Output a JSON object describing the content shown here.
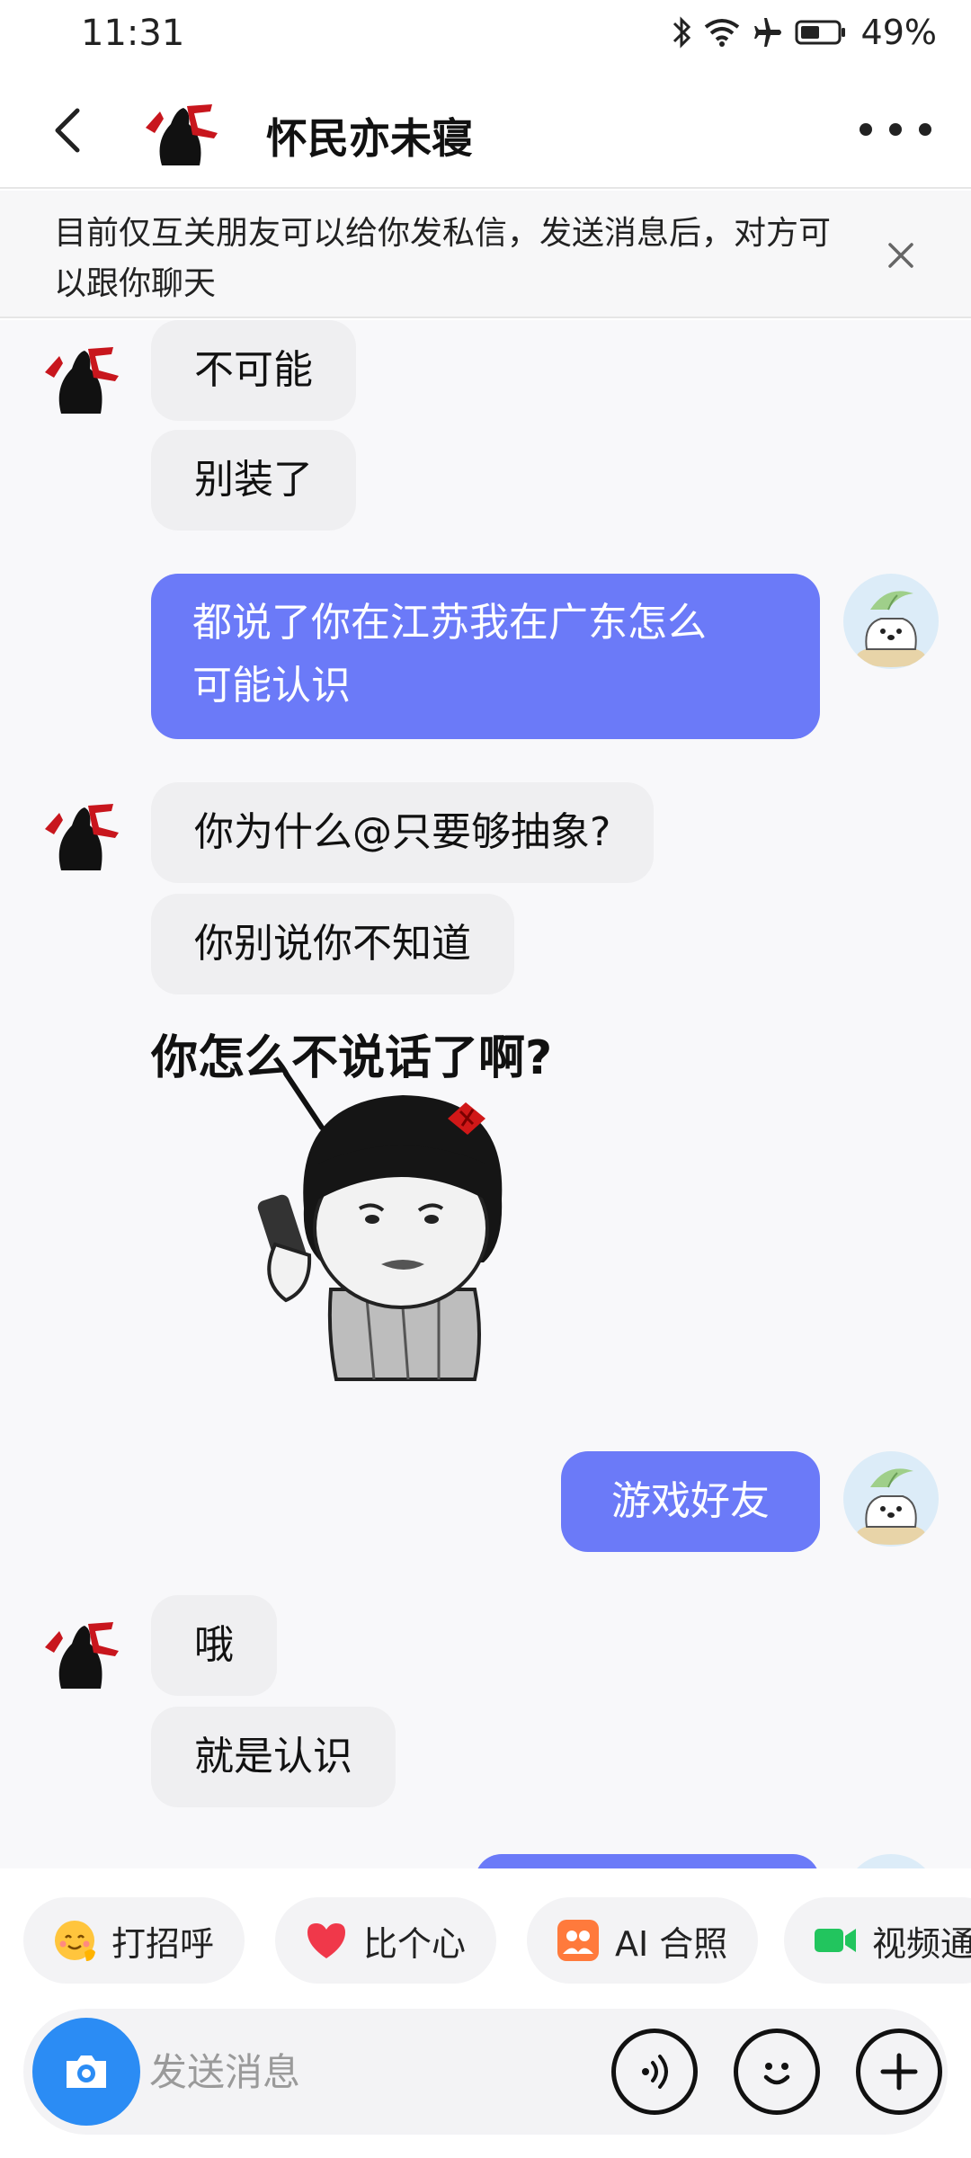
{
  "status_bar": {
    "time": "11:31",
    "battery": "49%"
  },
  "header": {
    "title": "怀民亦未寝"
  },
  "notice": {
    "text": "目前仅互关朋友可以给你发私信，发送消息后，对方可以跟你聊天"
  },
  "messages": [
    {
      "side": "in",
      "text": "不可能"
    },
    {
      "side": "in",
      "text": "别装了"
    },
    {
      "side": "out",
      "lines": [
        "都说了你在江苏我在广东怎么",
        "可能认识"
      ]
    },
    {
      "side": "in",
      "text": "你为什么@只要够抽象?"
    },
    {
      "side": "in",
      "text": "你别说你不知道"
    },
    {
      "side": "in",
      "sticker_text": "你怎么不说话了啊?"
    },
    {
      "side": "out",
      "text": "游戏好友"
    },
    {
      "side": "in",
      "text": "哦"
    },
    {
      "side": "in",
      "text": "就是认识"
    }
  ],
  "quick_actions": [
    {
      "label": "打招呼",
      "icon": "waving-emoji-icon"
    },
    {
      "label": "比个心",
      "icon": "heart-icon"
    },
    {
      "label": "AI 合照",
      "icon": "ai-photo-icon"
    },
    {
      "label": "视频通",
      "icon": "video-call-icon"
    }
  ],
  "input": {
    "placeholder": "发送消息"
  },
  "colors": {
    "accent": "#6b7af8",
    "camera": "#2b8cf4",
    "incoming_bubble": "#efeff1"
  }
}
